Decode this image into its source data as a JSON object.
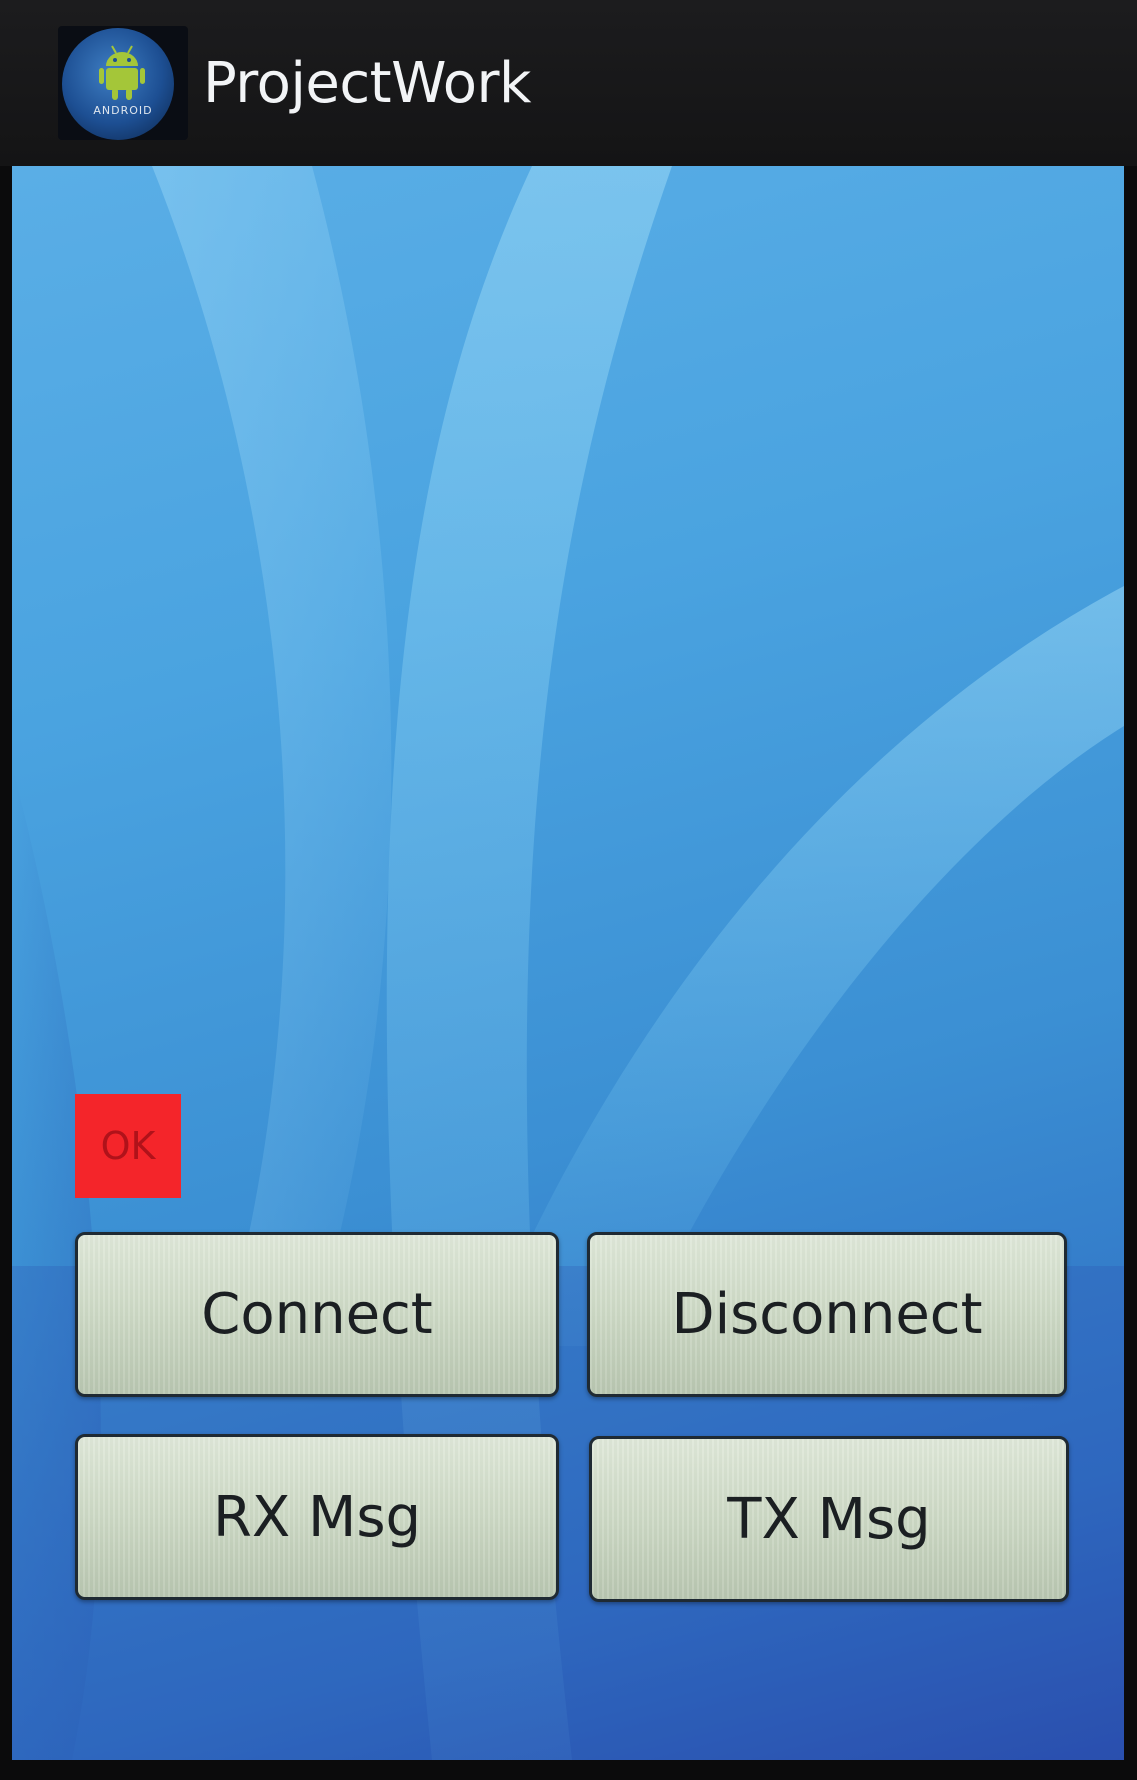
{
  "app": {
    "title": "ProjectWork",
    "icon": "android-robot-icon",
    "icon_brand_text": "ANDROID"
  },
  "status": {
    "label": "OK",
    "color": "#f4252a"
  },
  "buttons": {
    "connect": "Connect",
    "disconnect": "Disconnect",
    "rx_msg": "RX Msg",
    "tx_msg": "TX Msg"
  },
  "colors": {
    "action_bar": "#1a1a1c",
    "background_blue": "#4aa3e0",
    "button_face": "#cdd9c5",
    "android_green": "#a4c639"
  }
}
